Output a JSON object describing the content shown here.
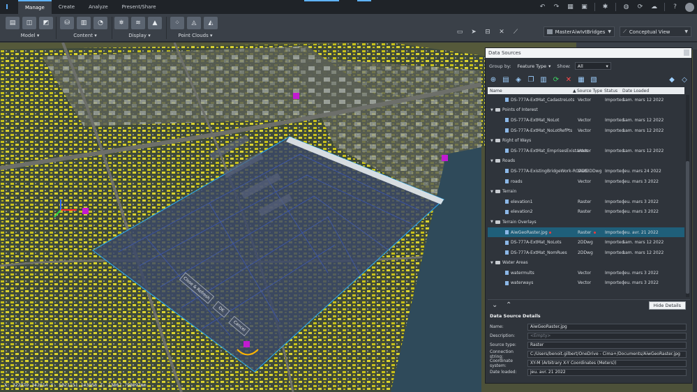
{
  "ribbon_tabs": [
    "Manage",
    "Create",
    "Analyze",
    "Present/Share"
  ],
  "ribbon_groups": {
    "model": "Model",
    "content": "Content",
    "display": "Display",
    "point_clouds": "Point Clouds"
  },
  "model_dropdown": "MasterAiwIvtBridges",
  "view_dropdown": "Conceptual View",
  "coordinates": "X: 322979.342014 Y: 5021151.143958 Z: 13867.798097mm",
  "data_sources": {
    "title": "Data Sources",
    "group_by_label": "Group by:",
    "group_by_value": "Feature Type",
    "show_label": "Show:",
    "show_value": "All",
    "columns": {
      "name": "Name",
      "source_type": "Source Type",
      "status": "Status",
      "date_loaded": "Date Loaded"
    },
    "rows": [
      {
        "kind": "item",
        "name": "DS-777A-ExtMat_CadastreLots",
        "type": "Vector",
        "status": "Imported",
        "date": "sam. mars 12 2022"
      },
      {
        "kind": "folder",
        "name": "Points of Interest"
      },
      {
        "kind": "item",
        "name": "DS-777A-ExtMat_NoLot",
        "type": "Vector",
        "status": "Imported",
        "date": "sam. mars 12 2022"
      },
      {
        "kind": "item",
        "name": "DS-777A-ExtMat_NoLotRefPts",
        "type": "Vector",
        "status": "Imported",
        "date": "sam. mars 12 2022"
      },
      {
        "kind": "folder",
        "name": "Right of Ways"
      },
      {
        "kind": "item",
        "name": "DS-777A-ExtMat_EmprisesExistantes",
        "type": "Vector",
        "status": "Imported",
        "date": "sam. mars 12 2022"
      },
      {
        "kind": "folder",
        "name": "Roads"
      },
      {
        "kind": "item",
        "name": "DS-777A-ExistingBridgeWork-ROADS",
        "type": "Civil3DDwg",
        "status": "Imported",
        "date": "jeu. mars 24 2022"
      },
      {
        "kind": "item",
        "name": "roads",
        "type": "Vector",
        "status": "Imported",
        "date": "jeu. mars 3 2022"
      },
      {
        "kind": "folder",
        "name": "Terrain"
      },
      {
        "kind": "item",
        "name": "elevation1",
        "type": "Raster",
        "status": "Imported",
        "date": "jeu. mars 3 2022"
      },
      {
        "kind": "item",
        "name": "elevation2",
        "type": "Raster",
        "status": "Imported",
        "date": "jeu. mars 3 2022"
      },
      {
        "kind": "folder",
        "name": "Terrain Overlays"
      },
      {
        "kind": "item",
        "name": "AiwGeoRaster.jpg",
        "type": "Raster",
        "status": "Imported",
        "date": "jeu. avr. 21 2022",
        "selected": true
      },
      {
        "kind": "item",
        "name": "DS-777A-ExtMat_NoLots",
        "type": "2DDwg",
        "status": "Imported",
        "date": "sam. mars 12 2022"
      },
      {
        "kind": "item",
        "name": "DS-777A-ExtMat_NomRues",
        "type": "2DDwg",
        "status": "Imported",
        "date": "sam. mars 12 2022"
      },
      {
        "kind": "folder",
        "name": "Water Areas"
      },
      {
        "kind": "item",
        "name": "watermults",
        "type": "Vector",
        "status": "Imported",
        "date": "jeu. mars 3 2022"
      },
      {
        "kind": "item",
        "name": "waterways",
        "type": "Vector",
        "status": "Imported",
        "date": "jeu. mars 3 2022"
      }
    ],
    "hide_details": "Hide Details",
    "details_title": "Data Source Details",
    "details": {
      "name_label": "Name:",
      "name": "AiwGeoRaster.jpg",
      "description_label": "Description:",
      "description": "<Empty>",
      "source_type_label": "Source type:",
      "source_type": "Raster",
      "connection_label": "Connection string:",
      "connection": "C:/Users/benoit.gilbert/OneDrive - Cima+/Documents/AiwGeoRaster.jpg",
      "coord_label": "Coordinate system:",
      "coord": "XY-M (Arbitrary X-Y Coordinates (Meters))",
      "date_label": "Date loaded:",
      "date": "jeu. avr. 21 2022"
    }
  },
  "overlay_buttons": {
    "close_refresh": "Close & Refresh",
    "ok": "OK",
    "cancel": "Cancel"
  },
  "colors": {
    "accent": "#5fb3ff",
    "selected_row": "#1f5f7a",
    "refresh_green": "#3fcf63",
    "delete_red": "#ff4b4b",
    "gizmo_magenta": "#c21bd1"
  }
}
